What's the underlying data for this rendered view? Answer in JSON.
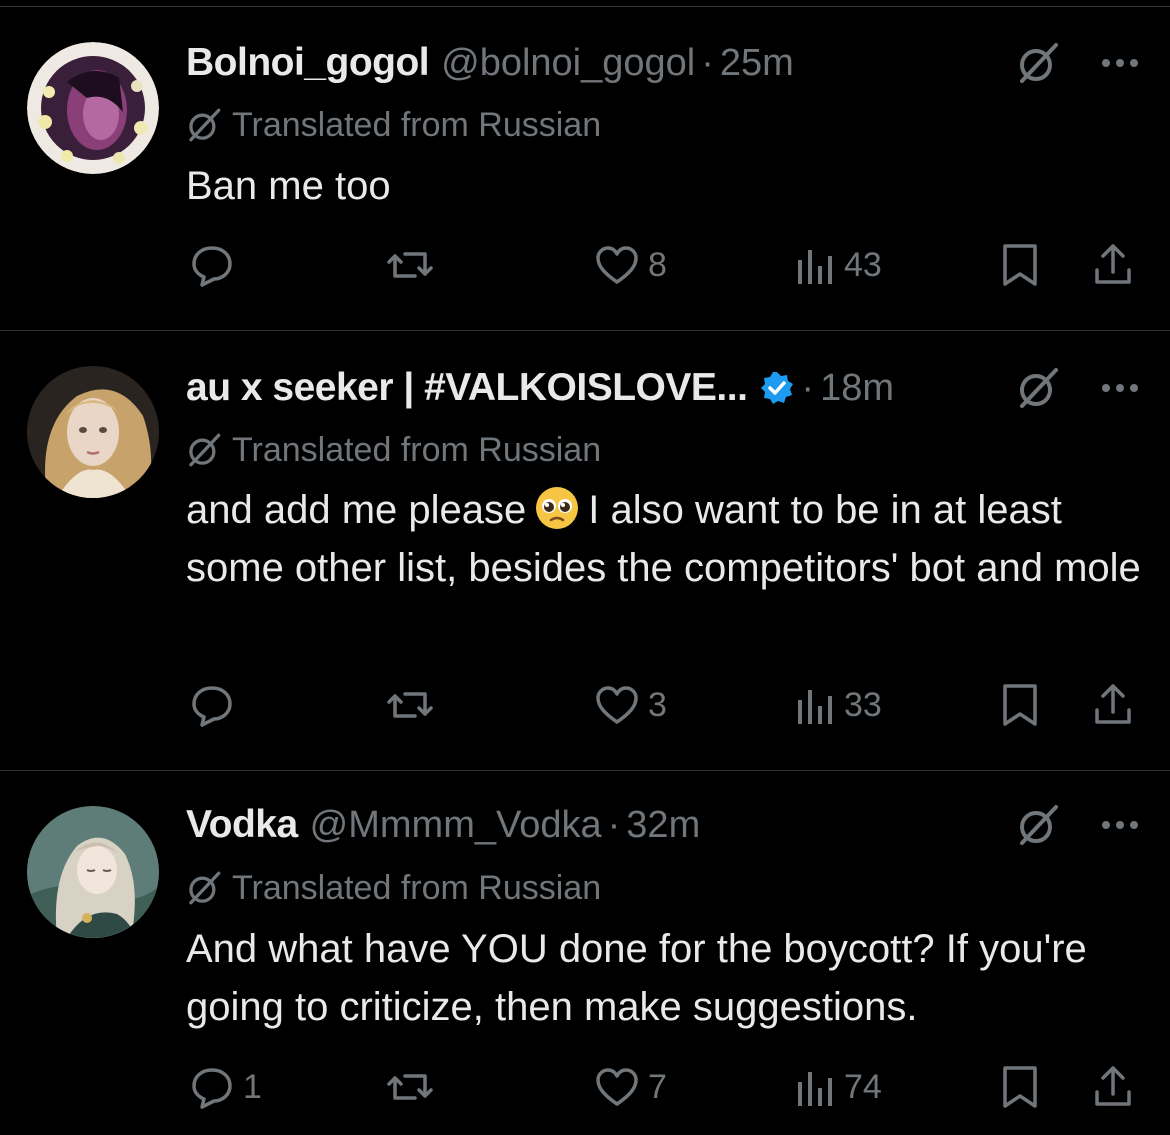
{
  "colors": {
    "background": "#000000",
    "text": "#e7e9ea",
    "muted": "#71767b",
    "divider": "#2f3336",
    "verified": "#1d9bf0"
  },
  "translated_label": "Translated from Russian",
  "tweets": [
    {
      "display_name": "Bolnoi_gogol",
      "handle": "@bolnoi_gogol",
      "separator": "·",
      "time": "25m",
      "verified": false,
      "text": "Ban me too",
      "replies": "",
      "reposts": "",
      "likes": "8",
      "views": "43"
    },
    {
      "display_name": "au x seeker | #VALKOISLOVE...",
      "handle": "",
      "separator": "·",
      "time": "18m",
      "verified": true,
      "text_before_emoji": "and add me please",
      "emoji": "pleading-face-emoji",
      "text_after_emoji": "I also want to be in at least some other list, besides the competitors' bot and mole",
      "replies": "",
      "reposts": "",
      "likes": "3",
      "views": "33"
    },
    {
      "display_name": "Vodka",
      "handle": "@Mmmm_Vodka",
      "separator": "·",
      "time": "32m",
      "verified": false,
      "text": "And what have YOU done for the boycott? If you're going to criticize, then make suggestions.",
      "replies": "1",
      "reposts": "",
      "likes": "7",
      "views": "74"
    }
  ]
}
